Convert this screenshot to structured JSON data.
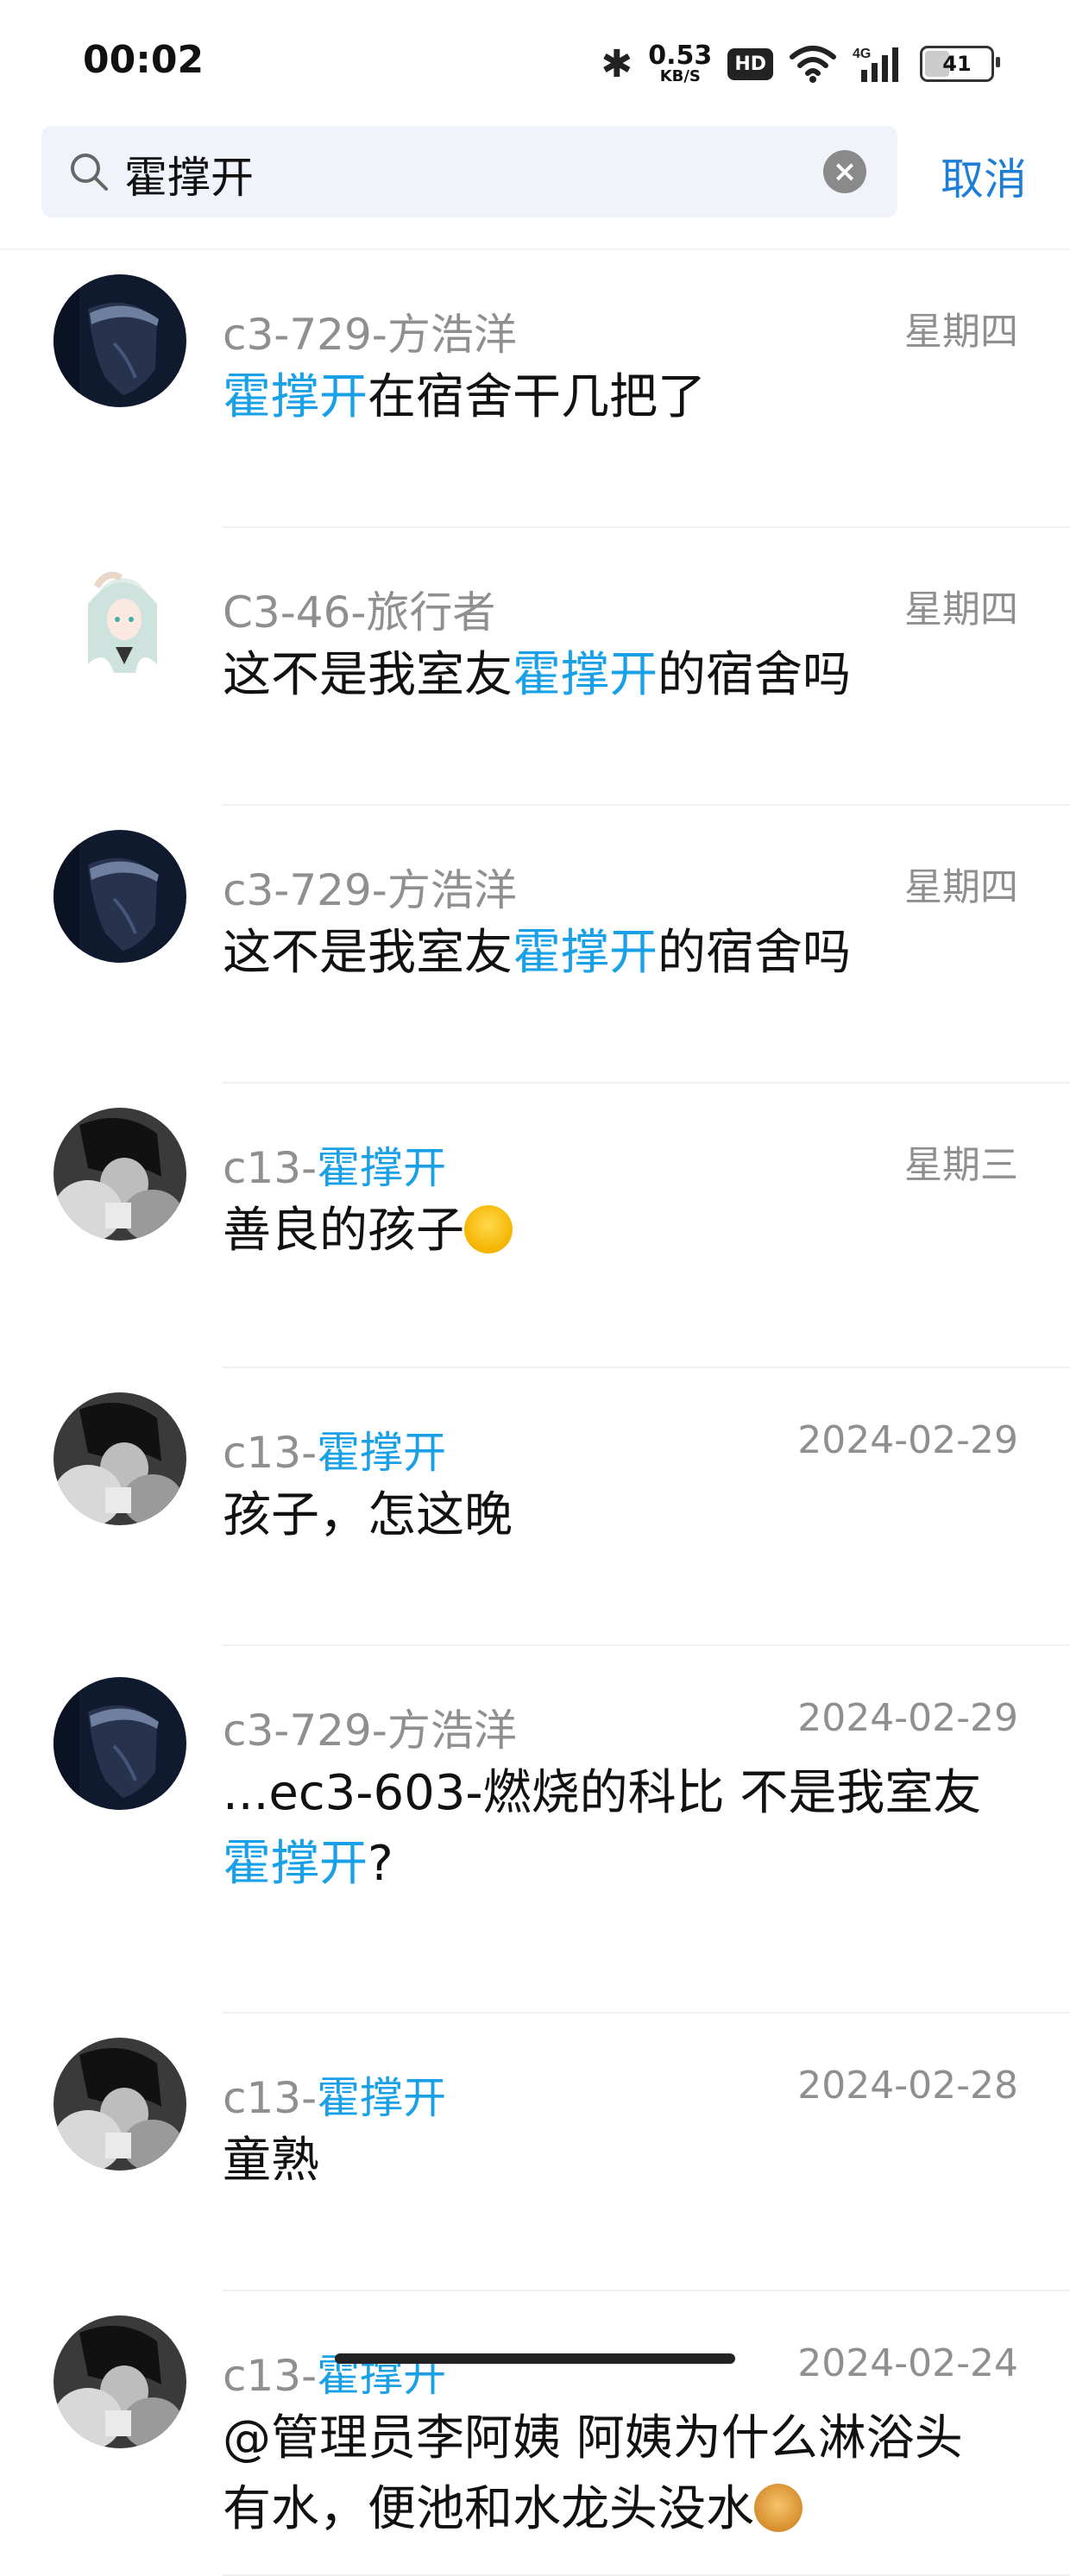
{
  "status_bar": {
    "time": "00:02",
    "speed_value": "0.53",
    "speed_unit": "KB/S",
    "hd_badge": "HD",
    "network": "4G",
    "battery": "41"
  },
  "search": {
    "query": "霍撑开",
    "cancel_label": "取消"
  },
  "colors": {
    "highlight": "#1aa0e6",
    "cancel": "#1c7ed6",
    "muted": "#8f8f8f"
  },
  "results": [
    {
      "avatar": "dark-anime-boy-avatar",
      "name_prefix": "c3-729-方浩洋",
      "name_hl": "",
      "date": "星期四",
      "message": [
        [
          "霍撑开",
          true
        ],
        [
          "在宿舍干几把了",
          false
        ]
      ]
    },
    {
      "avatar": "anime-girl-avatar",
      "name_prefix": "C3-46-旅行者",
      "name_hl": "",
      "date": "星期四",
      "message": [
        [
          "这不是我室友",
          false
        ],
        [
          "霍撑开",
          true
        ],
        [
          "的宿舍吗",
          false
        ]
      ]
    },
    {
      "avatar": "dark-anime-boy-avatar",
      "name_prefix": "c3-729-方浩洋",
      "name_hl": "",
      "date": "星期四",
      "message": [
        [
          "这不是我室友",
          false
        ],
        [
          "霍撑开",
          true
        ],
        [
          "的宿舍吗",
          false
        ]
      ]
    },
    {
      "avatar": "grayscale-boy-avatar",
      "name_prefix": "c13-",
      "name_hl": "霍撑开",
      "date": "星期三",
      "message": [
        [
          "善良的孩子",
          false
        ]
      ],
      "emoji": "crying-face-emoji"
    },
    {
      "avatar": "grayscale-boy-avatar",
      "name_prefix": "c13-",
      "name_hl": "霍撑开",
      "date": "2024-02-29",
      "message": [
        [
          "孩子，怎这晚",
          false
        ]
      ]
    },
    {
      "avatar": "dark-anime-boy-avatar",
      "name_prefix": "c3-729-方浩洋",
      "name_hl": "",
      "date": "2024-02-29",
      "message": [
        [
          "...ec3-603-燃烧的科比  不是我室友",
          false
        ],
        [
          "霍撑开",
          true
        ],
        [
          "?",
          false
        ]
      ]
    },
    {
      "avatar": "grayscale-boy-avatar",
      "name_prefix": "c13-",
      "name_hl": "霍撑开",
      "date": "2024-02-28",
      "message": [
        [
          "童熟",
          false
        ]
      ]
    },
    {
      "avatar": "grayscale-boy-avatar",
      "name_prefix": "c13-",
      "name_hl": "霍撑开",
      "date": "2024-02-24",
      "message": [
        [
          "@管理员李阿姨 阿姨为什么淋浴头有水，便池和水龙头没水",
          false
        ]
      ],
      "emoji": "dog-face-emoji"
    }
  ]
}
